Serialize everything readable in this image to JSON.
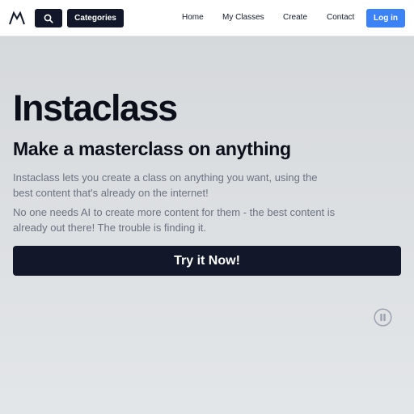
{
  "navbar": {
    "logo_icon": "mountain-logo-icon",
    "search_icon": "search-icon",
    "categories_label": "Categories",
    "links": [
      "Home",
      "My Classes",
      "Create",
      "Contact"
    ],
    "login_label": "Log in"
  },
  "hero": {
    "title": "Instaclass",
    "subtitle": "Make a masterclass on anything",
    "paragraph_1": "Instaclass lets you create a class on anything you want, using the best content that's already on the internet!",
    "paragraph_2": "No one needs AI to create more content for them - the best content is already out there! The trouble is finding it.",
    "cta_label": "Try it Now!",
    "pause_icon": "pause-icon"
  },
  "colors": {
    "dark": "#121829",
    "accent": "#3b82f6",
    "muted_text": "#6b7280"
  }
}
